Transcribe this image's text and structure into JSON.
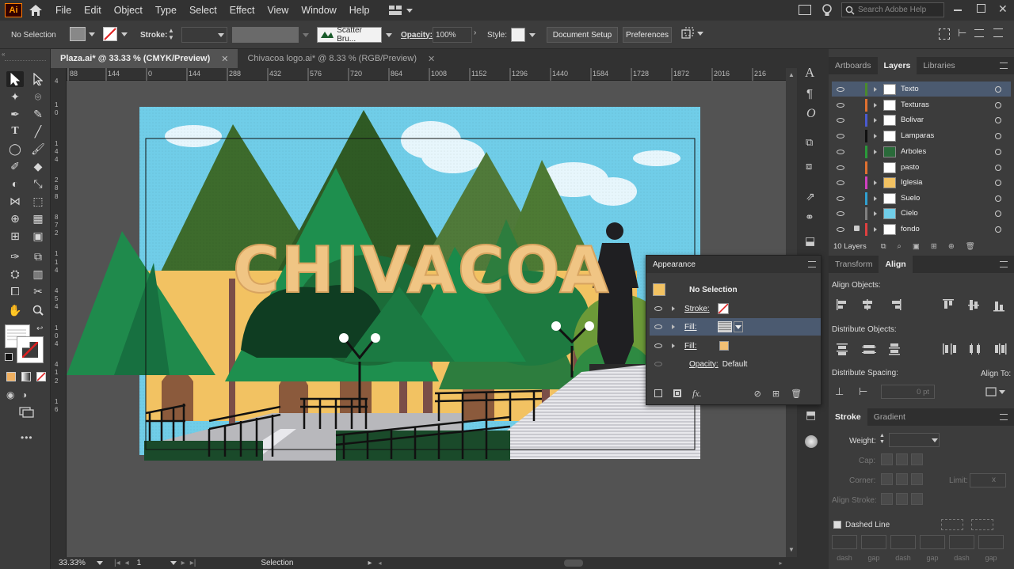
{
  "menubar": {
    "logo": "Ai",
    "items": [
      "File",
      "Edit",
      "Object",
      "Type",
      "Select",
      "Effect",
      "View",
      "Window",
      "Help"
    ],
    "search_placeholder": "Search Adobe Help"
  },
  "control_bar": {
    "selection": "No Selection",
    "stroke_label": "Stroke:",
    "brush_label": "Scatter Bru...",
    "opacity_label": "Opacity:",
    "opacity_value": "100%",
    "style_label": "Style:",
    "document_setup": "Document Setup",
    "preferences": "Preferences"
  },
  "tabs": [
    {
      "label": "Plaza.ai* @ 33.33 % (CMYK/Preview)",
      "active": true
    },
    {
      "label": "Chivacoa logo.ai* @ 8.33 % (RGB/Preview)",
      "active": false
    }
  ],
  "ruler_h": [
    "88",
    "144",
    "0",
    "144",
    "288",
    "432",
    "576",
    "720",
    "864",
    "1008",
    "1152",
    "1296",
    "1440",
    "1584",
    "1728",
    "1872",
    "2016",
    "216"
  ],
  "ruler_v": [
    "4",
    "1",
    "0",
    "1",
    "4",
    "4",
    "2",
    "8",
    "8",
    "8",
    "7",
    "2",
    "1",
    "1",
    "4",
    "4",
    "5",
    "4",
    "1",
    "0",
    "4",
    "4",
    "1",
    "2",
    "1",
    "6"
  ],
  "artwork": {
    "title": "CHIVACOA"
  },
  "status": {
    "zoom": "33.33%",
    "page": "1",
    "mode": "Selection"
  },
  "panel_tabs_top": [
    {
      "label": "Artboards"
    },
    {
      "label": "Layers",
      "active": true
    },
    {
      "label": "Libraries"
    }
  ],
  "layers": [
    {
      "name": "Texto",
      "color": "#4a8a2c",
      "selected": true
    },
    {
      "name": "Texturas",
      "color": "#e07030"
    },
    {
      "name": "Bolivar",
      "color": "#4a5ad0"
    },
    {
      "name": "Lamparas",
      "color": "#101010"
    },
    {
      "name": "Arboles",
      "color": "#2a9a3a"
    },
    {
      "name": "pasto",
      "color": "#e07030"
    },
    {
      "name": "Iglesia",
      "color": "#d040c0"
    },
    {
      "name": "Suelo",
      "color": "#30a0d0"
    },
    {
      "name": "Cielo",
      "color": "#808080"
    },
    {
      "name": "fondo",
      "color": "#e04040"
    }
  ],
  "layers_count": "10 Layers",
  "panel_tabs_mid": [
    {
      "label": "Transform"
    },
    {
      "label": "Align",
      "active": true
    }
  ],
  "align": {
    "align_objects": "Align Objects:",
    "distribute_objects": "Distribute Objects:",
    "distribute_spacing": "Distribute Spacing:",
    "align_to": "Align To:",
    "spacing_value": "0 pt"
  },
  "panel_tabs_bottom": [
    {
      "label": "Stroke",
      "active": true
    },
    {
      "label": "Gradient"
    }
  ],
  "stroke": {
    "weight": "Weight:",
    "cap": "Cap:",
    "corner": "Corner:",
    "limit": "Limit:",
    "limit_x": "x",
    "align_stroke": "Align Stroke:",
    "dashed_line": "Dashed Line",
    "dash_labels": [
      "dash",
      "gap",
      "dash",
      "gap",
      "dash",
      "gap"
    ]
  },
  "appearance": {
    "title": "Appearance",
    "header": "No Selection",
    "rows": [
      {
        "label": "Stroke:"
      },
      {
        "label": "Fill:",
        "selected": true
      },
      {
        "label": "Fill:"
      },
      {
        "label": "Opacity:",
        "value": "Default"
      }
    ],
    "fx": "fx."
  }
}
